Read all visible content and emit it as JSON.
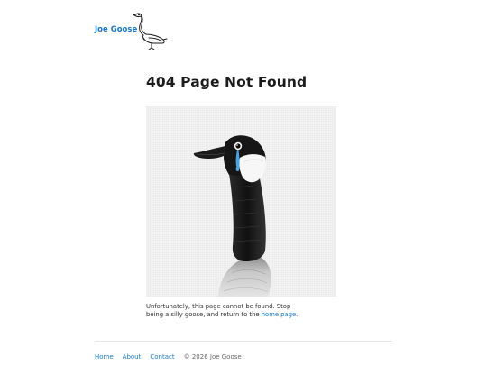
{
  "header": {
    "brand_name": "Joe Goose",
    "logo_icon": "goose-line-drawing-icon"
  },
  "main": {
    "title": "404 Page Not Found",
    "image_icon": "crying-goose-illustration",
    "message_before_link": "Unfortunately, this page cannot be found. Stop being a silly goose, and return to the ",
    "message_link": "home page",
    "message_after_link": "."
  },
  "footer": {
    "links": [
      "Home",
      "About",
      "Contact"
    ],
    "copyright": "© 2026 Joe Goose"
  },
  "colors": {
    "link": "#1a78c2",
    "text": "#222222",
    "tear": "#4aa3e0"
  }
}
